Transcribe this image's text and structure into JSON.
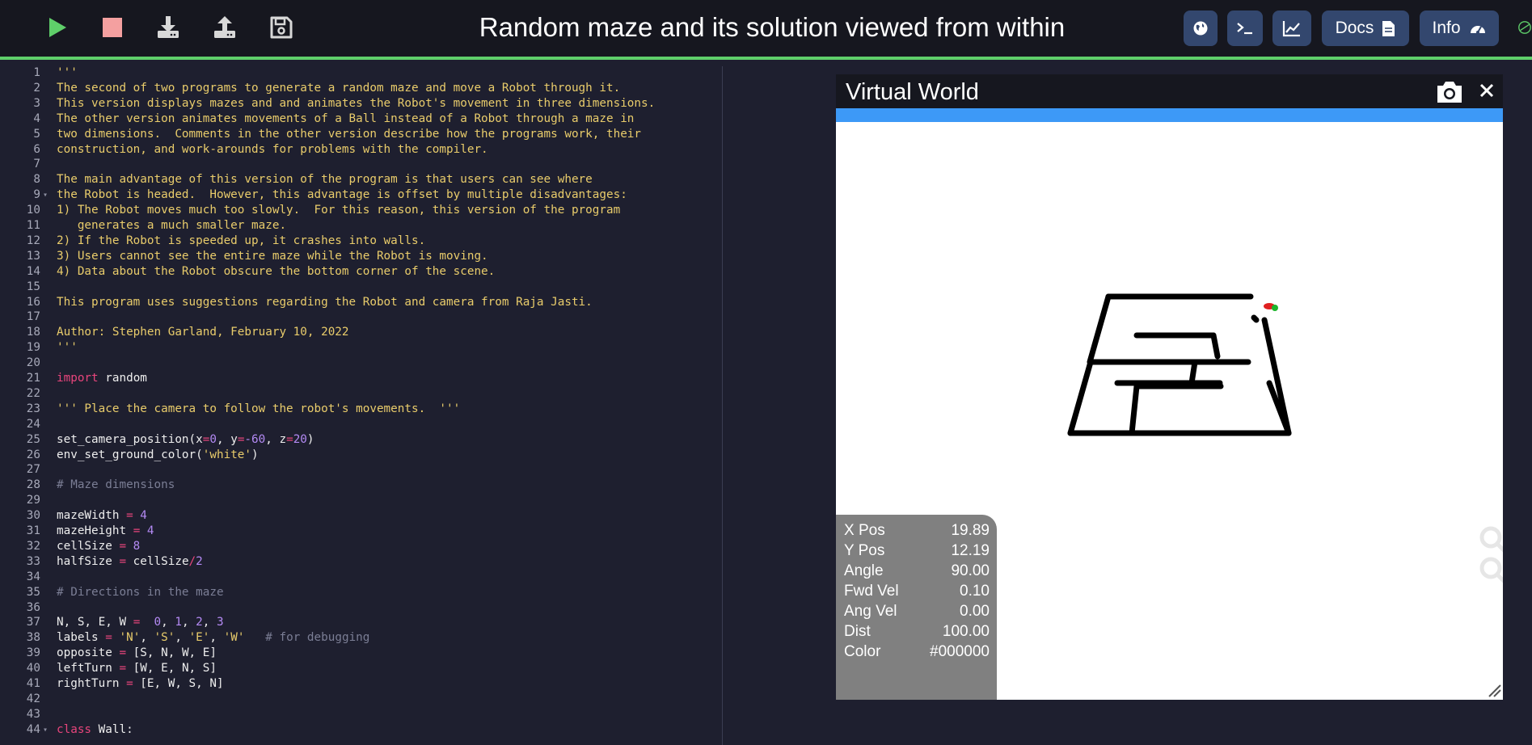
{
  "app": {
    "title": "Random maze and its solution viewed from within",
    "toolbar": {
      "run": "play-icon",
      "stop": "stop-icon",
      "download": "download-icon",
      "upload": "upload-icon",
      "save": "save-icon"
    },
    "right_buttons": {
      "world": "globe-icon",
      "terminal": "terminal-icon",
      "graph": "chart-icon",
      "docs_label": "Docs",
      "info_label": "Info"
    }
  },
  "editor": {
    "lines": [
      [
        [
          "doc",
          "'''"
        ]
      ],
      [
        [
          "doc",
          "The second of two programs to generate a random maze and move a Robot through it."
        ]
      ],
      [
        [
          "doc",
          "This version displays mazes and and animates the Robot's movement in three dimensions."
        ]
      ],
      [
        [
          "doc",
          "The other version animates movements of a Ball instead of a Robot through a maze in"
        ]
      ],
      [
        [
          "doc",
          "two dimensions.  Comments in the other version describe how the programs work, their"
        ]
      ],
      [
        [
          "doc",
          "construction, and work-arounds for problems with the compiler."
        ]
      ],
      [],
      [
        [
          "doc",
          "The main advantage of this version of the program is that users can see where"
        ]
      ],
      [
        [
          "doc",
          "the Robot is headed.  However, this advantage is offset by multiple disadvantages:"
        ]
      ],
      [
        [
          "doc",
          "1) The Robot moves much too slowly.  For this reason, this version of the program"
        ]
      ],
      [
        [
          "doc",
          "   generates a much smaller maze."
        ]
      ],
      [
        [
          "doc",
          "2) If the Robot is speeded up, it crashes into walls."
        ]
      ],
      [
        [
          "doc",
          "3) Users cannot see the entire maze while the Robot is moving."
        ]
      ],
      [
        [
          "doc",
          "4) Data about the Robot obscure the bottom corner of the scene."
        ]
      ],
      [],
      [
        [
          "doc",
          "This program uses suggestions regarding the Robot and camera from Raja Jasti."
        ]
      ],
      [],
      [
        [
          "doc",
          "Author: Stephen Garland, February 10, 2022"
        ]
      ],
      [
        [
          "doc",
          "'''"
        ]
      ],
      [],
      [
        [
          "kw",
          "import"
        ],
        [
          "p",
          " random"
        ]
      ],
      [],
      [
        [
          "doc",
          "''' Place the camera to follow the robot's movements.  '''"
        ]
      ],
      [],
      [
        [
          "p",
          "set_camera_position(x"
        ],
        [
          "op",
          "="
        ],
        [
          "num",
          "0"
        ],
        [
          "p",
          ", y"
        ],
        [
          "op",
          "="
        ],
        [
          "num",
          "-60"
        ],
        [
          "p",
          ", z"
        ],
        [
          "op",
          "="
        ],
        [
          "num",
          "20"
        ],
        [
          "p",
          ")"
        ]
      ],
      [
        [
          "p",
          "env_set_ground_color("
        ],
        [
          "str",
          "'white'"
        ],
        [
          "p",
          ")"
        ]
      ],
      [],
      [
        [
          "cm",
          "# Maze dimensions"
        ]
      ],
      [],
      [
        [
          "p",
          "mazeWidth "
        ],
        [
          "op",
          "="
        ],
        [
          "num",
          " 4"
        ]
      ],
      [
        [
          "p",
          "mazeHeight "
        ],
        [
          "op",
          "="
        ],
        [
          "num",
          " 4"
        ]
      ],
      [
        [
          "p",
          "cellSize "
        ],
        [
          "op",
          "="
        ],
        [
          "num",
          " 8"
        ]
      ],
      [
        [
          "p",
          "halfSize "
        ],
        [
          "op",
          "="
        ],
        [
          "p",
          " cellSize"
        ],
        [
          "op",
          "/"
        ],
        [
          "num",
          "2"
        ]
      ],
      [],
      [
        [
          "cm",
          "# Directions in the maze"
        ]
      ],
      [],
      [
        [
          "p",
          "N, S, E, W "
        ],
        [
          "op",
          "="
        ],
        [
          "p",
          "  "
        ],
        [
          "num",
          "0"
        ],
        [
          "p",
          ", "
        ],
        [
          "num",
          "1"
        ],
        [
          "p",
          ", "
        ],
        [
          "num",
          "2"
        ],
        [
          "p",
          ", "
        ],
        [
          "num",
          "3"
        ]
      ],
      [
        [
          "p",
          "labels "
        ],
        [
          "op",
          "="
        ],
        [
          "p",
          " "
        ],
        [
          "str",
          "'N'"
        ],
        [
          "p",
          ", "
        ],
        [
          "str",
          "'S'"
        ],
        [
          "p",
          ", "
        ],
        [
          "str",
          "'E'"
        ],
        [
          "p",
          ", "
        ],
        [
          "str",
          "'W'"
        ],
        [
          "p",
          "   "
        ],
        [
          "cm",
          "# for debugging"
        ]
      ],
      [
        [
          "p",
          "opposite "
        ],
        [
          "op",
          "="
        ],
        [
          "p",
          " [S, N, W, E]"
        ]
      ],
      [
        [
          "p",
          "leftTurn "
        ],
        [
          "op",
          "="
        ],
        [
          "p",
          " [W, E, N, S]"
        ]
      ],
      [
        [
          "p",
          "rightTurn "
        ],
        [
          "op",
          "="
        ],
        [
          "p",
          " [E, W, S, N]"
        ]
      ],
      [],
      [],
      [
        [
          "kw",
          "class"
        ],
        [
          "p",
          " Wall:"
        ]
      ]
    ],
    "fold_lines": [
      9,
      44
    ]
  },
  "virtual_world": {
    "title": "Virtual World",
    "camera": "camera-icon",
    "close": "close-icon",
    "hud": [
      {
        "key": "X Pos",
        "value": "19.89"
      },
      {
        "key": "Y Pos",
        "value": "12.19"
      },
      {
        "key": "Angle",
        "value": "90.00"
      },
      {
        "key": "Fwd Vel",
        "value": "0.10"
      },
      {
        "key": "Ang Vel",
        "value": "0.00"
      },
      {
        "key": "Dist",
        "value": "100.00"
      },
      {
        "key": "Color",
        "value": "#000000"
      }
    ]
  },
  "colors": {
    "topbar": "#16171f",
    "editor_bg": "#1e1f2f",
    "accent_green": "#5fcf6a",
    "pill": "#33476e",
    "world_bar": "#3d99f7",
    "hud_bg": "#808080"
  }
}
